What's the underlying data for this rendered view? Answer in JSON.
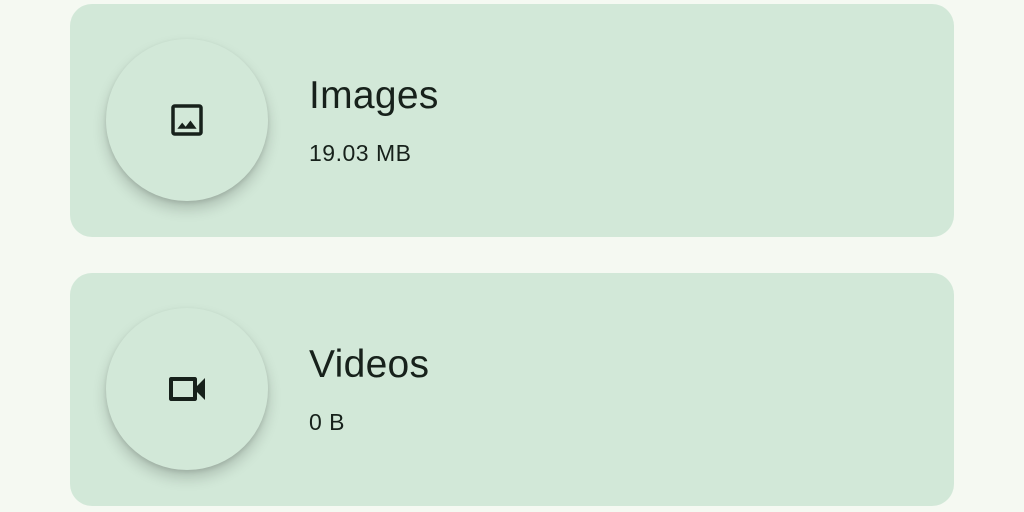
{
  "categories": [
    {
      "title": "Images",
      "size": "19.03 MB",
      "icon": "image-icon"
    },
    {
      "title": "Videos",
      "size": "0 B",
      "icon": "videocam-icon"
    }
  ],
  "colors": {
    "background": "#f5f9f2",
    "card": "#d2e8d8",
    "text": "#17211b"
  }
}
